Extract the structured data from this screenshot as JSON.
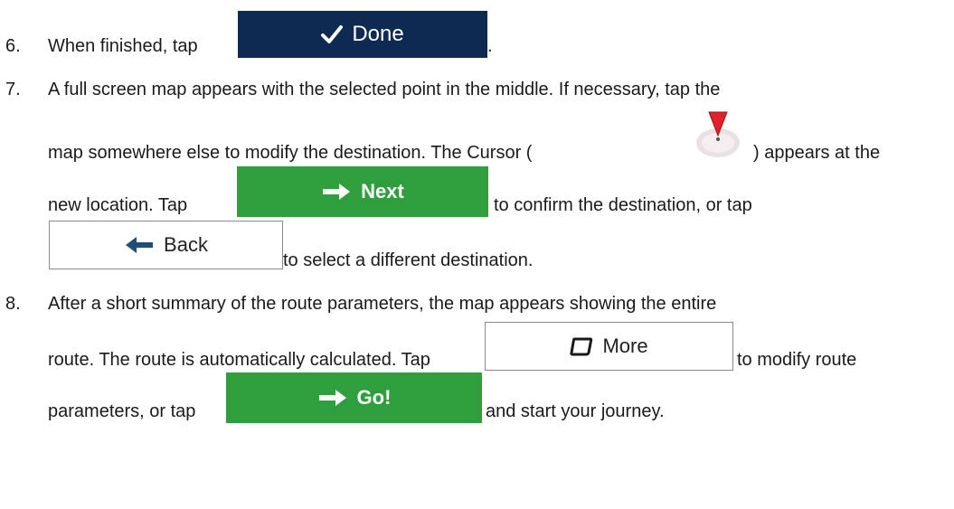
{
  "steps": [
    {
      "number": "6.",
      "lines": {
        "l1_before": "When finished, tap",
        "l1_after": "."
      },
      "button": {
        "label": "Done",
        "icon": "checkmark-icon"
      }
    },
    {
      "number": "7.",
      "lines": {
        "l1": "A full screen map appears with the selected point in the middle. If necessary, tap the",
        "l2_before": "map somewhere else to modify the destination. The Cursor (",
        "l2_after": ") appears at the",
        "l3_before": "new location. Tap",
        "l3_after": "to confirm the destination, or tap",
        "l4_after": "to select a different destination."
      },
      "next_button": {
        "label": "Next",
        "icon": "arrow-right-icon"
      },
      "back_button": {
        "label": "Back",
        "icon": "arrow-left-icon"
      },
      "cursor_icon": "map-cursor-icon"
    },
    {
      "number": "8.",
      "lines": {
        "l1": "After a short summary of the route parameters, the map appears showing the entire",
        "l2_before": "route. The route is automatically calculated. Tap",
        "l2_after": "to modify route",
        "l3_before": "parameters, or tap",
        "l3_after": "and start your journey."
      },
      "more_button": {
        "label": "More",
        "icon": "rounded-square-icon"
      },
      "go_button": {
        "label": "Go!",
        "icon": "arrow-right-icon"
      }
    }
  ],
  "colors": {
    "done_bg": "#0e2a52",
    "green_bg": "#2f9e3c",
    "text": "#1a1a1a"
  }
}
